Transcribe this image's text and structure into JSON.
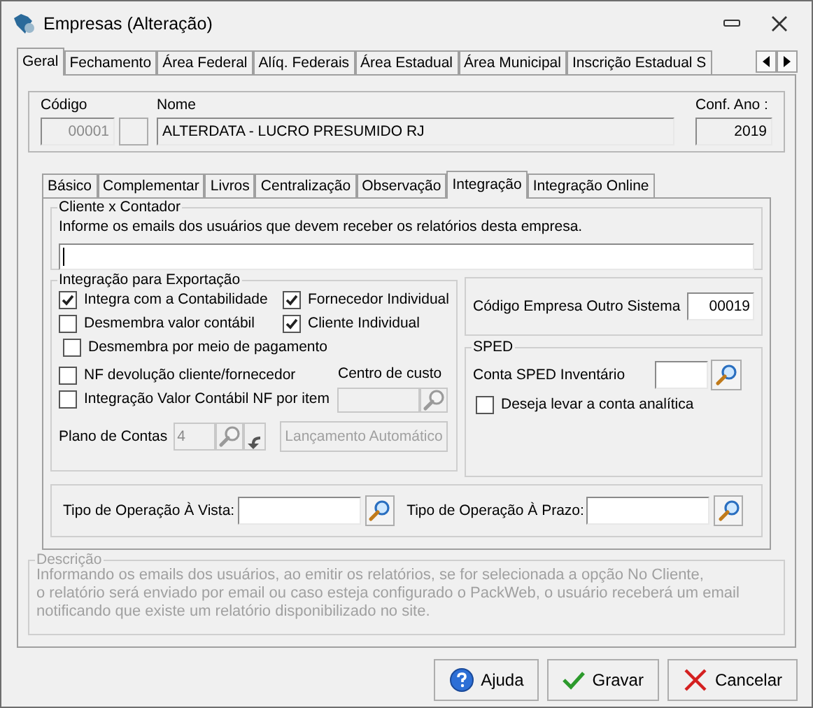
{
  "window": {
    "title": "Empresas (Alteração)"
  },
  "tabs": [
    {
      "label": "Geral",
      "selected": true
    },
    {
      "label": "Fechamento",
      "selected": false
    },
    {
      "label": "Área Federal",
      "selected": false
    },
    {
      "label": "Alíq. Federais",
      "selected": false
    },
    {
      "label": "Área Estadual",
      "selected": false
    },
    {
      "label": "Área Municipal",
      "selected": false
    },
    {
      "label": "Inscrição Estadual S",
      "selected": false
    }
  ],
  "header": {
    "codigo_label": "Código",
    "codigo": "00001",
    "nome_label": "Nome",
    "nome": "ALTERDATA - LUCRO PRESUMIDO RJ",
    "conf_ano_label": "Conf. Ano :",
    "conf_ano": "2019"
  },
  "subtabs": [
    {
      "label": "Básico",
      "selected": false
    },
    {
      "label": "Complementar",
      "selected": false
    },
    {
      "label": "Livros",
      "selected": false
    },
    {
      "label": "Centralização",
      "selected": false
    },
    {
      "label": "Observação",
      "selected": false
    },
    {
      "label": "Integração",
      "selected": true
    },
    {
      "label": "Integração Online",
      "selected": false
    }
  ],
  "cliente_contador": {
    "title": "Cliente x Contador",
    "instruction": "Informe os emails dos usuários que devem receber os relatórios desta empresa."
  },
  "exportacao": {
    "title": "Integração para Exportação",
    "checkbox_rows": [
      [
        {
          "label": "Integra com a Contabilidade",
          "checked": true
        },
        {
          "label": "Fornecedor Individual",
          "checked": true
        }
      ],
      [
        {
          "label": "Desmembra valor contábil",
          "checked": false
        },
        {
          "label": "Cliente Individual",
          "checked": true
        }
      ],
      [
        {
          "label": "Desmembra por meio de pagamento",
          "checked": false
        }
      ]
    ],
    "nf_devolucao": {
      "label": "NF devolução cliente/fornecedor",
      "checked": false
    },
    "centro_custo": {
      "label": "Centro de custo",
      "disabled": true
    },
    "valor_item": {
      "label": "Integração Valor Contábil NF por item",
      "checked": false
    },
    "plano": {
      "label": "Plano de Contas",
      "value": "4",
      "disabled": true
    },
    "lancamento_button": {
      "label": "Lançamento Automático",
      "disabled": true
    }
  },
  "outro_sistema": {
    "label": "Código Empresa Outro Sistema",
    "value": "00019"
  },
  "sped": {
    "title": "SPED",
    "conta_label": "Conta SPED Inventário",
    "checkbox": {
      "label": "Deseja levar a conta analítica",
      "checked": false
    }
  },
  "operacao": [
    {
      "label": "Tipo de Operação À Vista:"
    },
    {
      "label": "Tipo de Operação À Prazo:"
    }
  ],
  "descricao": {
    "title": "Descrição",
    "lines": [
      "Informando os emails dos usuários, ao emitir os relatórios, se for selecionada a opção No Cliente,",
      "o relatório será enviado por email ou caso esteja configurado o PackWeb, o usuário receberá um email",
      "notificando que existe um relatório disponibilizado no site."
    ]
  },
  "buttons": [
    {
      "label": "Ajuda",
      "kind": "help"
    },
    {
      "label": "Gravar",
      "kind": "save"
    },
    {
      "label": "Cancelar",
      "kind": "cancel"
    }
  ]
}
